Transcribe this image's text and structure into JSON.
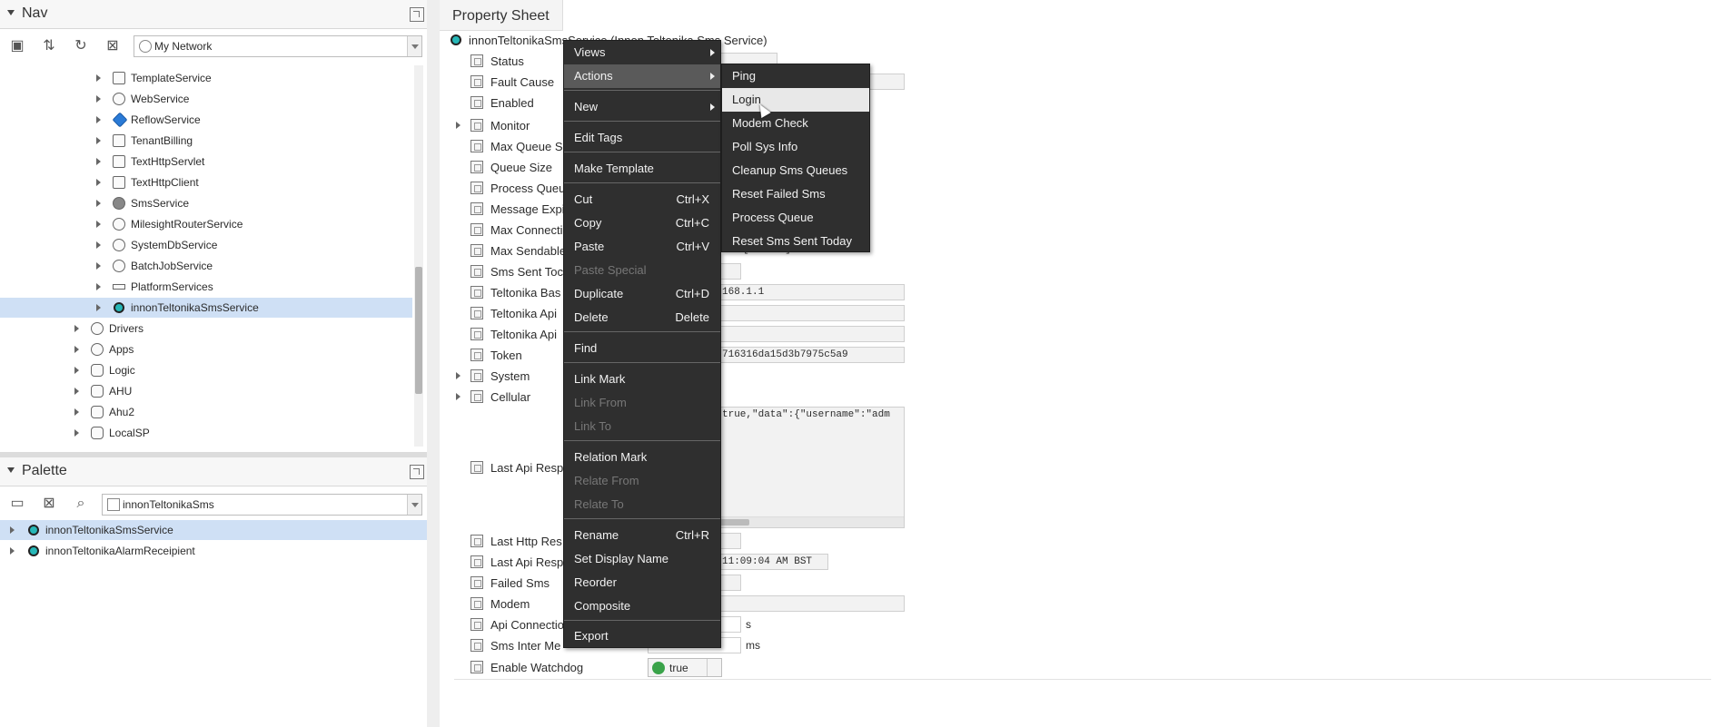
{
  "nav": {
    "title": "Nav",
    "network_selector": "My Network",
    "tree": [
      {
        "label": "TemplateService",
        "icon": "template-icon"
      },
      {
        "label": "WebService",
        "icon": "globe-icon"
      },
      {
        "label": "ReflowService",
        "icon": "reflow-icon"
      },
      {
        "label": "TenantBilling",
        "icon": "box-icon"
      },
      {
        "label": "TextHttpServlet",
        "icon": "box-icon"
      },
      {
        "label": "TextHttpClient",
        "icon": "box-icon"
      },
      {
        "label": "SmsService",
        "icon": "sms-icon"
      },
      {
        "label": "MilesightRouterService",
        "icon": "globe-icon"
      },
      {
        "label": "SystemDbService",
        "icon": "globe-icon"
      },
      {
        "label": "BatchJobService",
        "icon": "batch-icon"
      },
      {
        "label": "PlatformServices",
        "icon": "platform-icon"
      },
      {
        "label": "innonTeltonikaSmsService",
        "icon": "teal-icon"
      }
    ],
    "tree_top": [
      {
        "label": "Drivers",
        "icon": "drivers-icon"
      },
      {
        "label": "Apps",
        "icon": "apps-icon"
      },
      {
        "label": "Logic",
        "icon": "box-icon"
      },
      {
        "label": "AHU",
        "icon": "box-icon"
      },
      {
        "label": "Ahu2",
        "icon": "box-icon"
      },
      {
        "label": "LocalSP",
        "icon": "box-icon"
      }
    ]
  },
  "palette": {
    "title": "Palette",
    "module_selector": "innonTeltonikaSms",
    "items": [
      {
        "label": "innonTeltonikaSmsService"
      },
      {
        "label": "innonTeltonikaAlarmReceipient"
      }
    ]
  },
  "property_sheet": {
    "tab_label": "Property Sheet",
    "header": "innonTeltonikaSmsService  (Innon Teltonika Sms Service)",
    "rows": [
      {
        "label": "Status",
        "value": ""
      },
      {
        "label": "Fault Cause",
        "value": ""
      },
      {
        "label": "Enabled",
        "value": ""
      },
      {
        "label": "Monitor",
        "value": ""
      },
      {
        "label": "Max Queue Si",
        "value": ""
      },
      {
        "label": "Queue Size",
        "value": ""
      },
      {
        "label": "Process Queu",
        "value": ""
      },
      {
        "label": "Message Expi",
        "value": ""
      },
      {
        "label": "Max Connecti",
        "value": ""
      },
      {
        "label": "Max Sendable",
        "value": "[1-1000]"
      },
      {
        "label": "Sms Sent Toc",
        "value": ""
      },
      {
        "label": "Teltonika Bas",
        "value": "168.1.1"
      },
      {
        "label": "Teltonika Api",
        "value": ""
      },
      {
        "label": "Teltonika Api",
        "value": ""
      },
      {
        "label": "Token",
        "value": "716316da15d3b7975c5a9"
      },
      {
        "label": "System",
        "value": ""
      },
      {
        "label": "Cellular",
        "value": ""
      },
      {
        "label": "Last Api Resp",
        "value": "true,\"data\":{\"username\":\"adm"
      },
      {
        "label": "Last Http Res",
        "value": ""
      },
      {
        "label": "Last Api Resp",
        "value": "11:09:04 AM BST"
      },
      {
        "label": "Failed Sms",
        "value": ""
      },
      {
        "label": "Modem",
        "value": ""
      },
      {
        "label": "Api Connectio",
        "value": "s"
      },
      {
        "label": "Sms Inter Me",
        "value": "ms"
      },
      {
        "label": "Enable Watchdog",
        "value": "true"
      }
    ]
  },
  "context_menu": {
    "items": [
      {
        "label": "Views",
        "shortcut": "",
        "submenu": true
      },
      {
        "label": "Actions",
        "shortcut": "",
        "submenu": true
      },
      {
        "label": "New",
        "shortcut": "",
        "submenu": true
      },
      {
        "label": "Edit Tags",
        "shortcut": ""
      },
      {
        "label": "Make Template",
        "shortcut": ""
      },
      {
        "label": "Cut",
        "shortcut": "Ctrl+X"
      },
      {
        "label": "Copy",
        "shortcut": "Ctrl+C"
      },
      {
        "label": "Paste",
        "shortcut": "Ctrl+V"
      },
      {
        "label": "Paste Special",
        "shortcut": "",
        "disabled": true
      },
      {
        "label": "Duplicate",
        "shortcut": "Ctrl+D"
      },
      {
        "label": "Delete",
        "shortcut": "Delete"
      },
      {
        "label": "Find",
        "shortcut": ""
      },
      {
        "label": "Link Mark",
        "shortcut": ""
      },
      {
        "label": "Link From",
        "shortcut": "",
        "disabled": true
      },
      {
        "label": "Link To",
        "shortcut": "",
        "disabled": true
      },
      {
        "label": "Relation Mark",
        "shortcut": ""
      },
      {
        "label": "Relate From",
        "shortcut": "",
        "disabled": true
      },
      {
        "label": "Relate To",
        "shortcut": "",
        "disabled": true
      },
      {
        "label": "Rename",
        "shortcut": "Ctrl+R"
      },
      {
        "label": "Set Display Name",
        "shortcut": ""
      },
      {
        "label": "Reorder",
        "shortcut": ""
      },
      {
        "label": "Composite",
        "shortcut": ""
      },
      {
        "label": "Export",
        "shortcut": ""
      }
    ]
  },
  "actions_submenu": {
    "items": [
      {
        "label": "Ping"
      },
      {
        "label": "Login"
      },
      {
        "label": "Modem Check"
      },
      {
        "label": "Poll Sys Info"
      },
      {
        "label": "Cleanup Sms Queues"
      },
      {
        "label": "Reset Failed Sms"
      },
      {
        "label": "Process Queue"
      },
      {
        "label": "Reset Sms Sent Today"
      }
    ]
  }
}
